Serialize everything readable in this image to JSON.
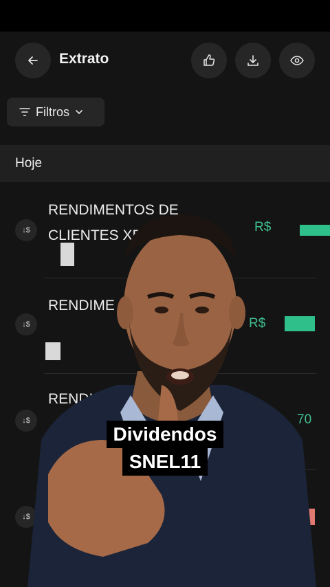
{
  "header": {
    "title": "Extrato",
    "back_icon": "arrow-left-icon",
    "actions": [
      "thumbs-up-icon",
      "download-icon",
      "eye-icon"
    ]
  },
  "filters": {
    "label": "Filtros",
    "icon": "filter-lines-icon",
    "chevron": "chevron-down-icon"
  },
  "section": {
    "label": "Hoje"
  },
  "transactions": [
    {
      "description": "RENDIMENTOS DE CLIENTES XPIN",
      "amount": "R$"
    },
    {
      "description": "RENDIME CLIENTES",
      "amount": "R$"
    },
    {
      "description": "RENDIM",
      "amount": "70"
    },
    {
      "description": "",
      "amount": ""
    }
  ],
  "caption": {
    "line1": "Dividendos",
    "line2": "SNEL11"
  },
  "colors": {
    "accent_green": "#3fbf8f",
    "background": "#141414",
    "caption_bg": "#000000"
  }
}
